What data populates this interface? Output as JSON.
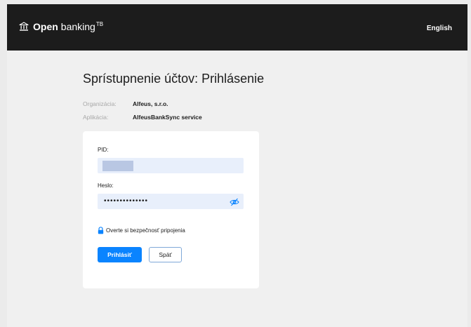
{
  "header": {
    "brand_strong": "Open",
    "brand_rest": "banking",
    "brand_sup": "TB",
    "language_link": "English"
  },
  "page": {
    "title": "Sprístupnenie účtov: Prihlásenie"
  },
  "meta": {
    "organization_label": "Organizácia:",
    "organization_value": "Alfeus, s.r.o.",
    "application_label": "Aplikácia:",
    "application_value": "AlfeusBankSync service"
  },
  "form": {
    "pid_label": "PID:",
    "password_label": "Heslo:",
    "password_masked": "••••••••••••••",
    "security_link": "Overte si bezpečnosť pripojenia",
    "login_button": "Prihlásiť",
    "back_button": "Späť"
  },
  "colors": {
    "header_bg": "#1c1c1c",
    "primary": "#0a84ff",
    "field_bg": "#e8effb"
  }
}
